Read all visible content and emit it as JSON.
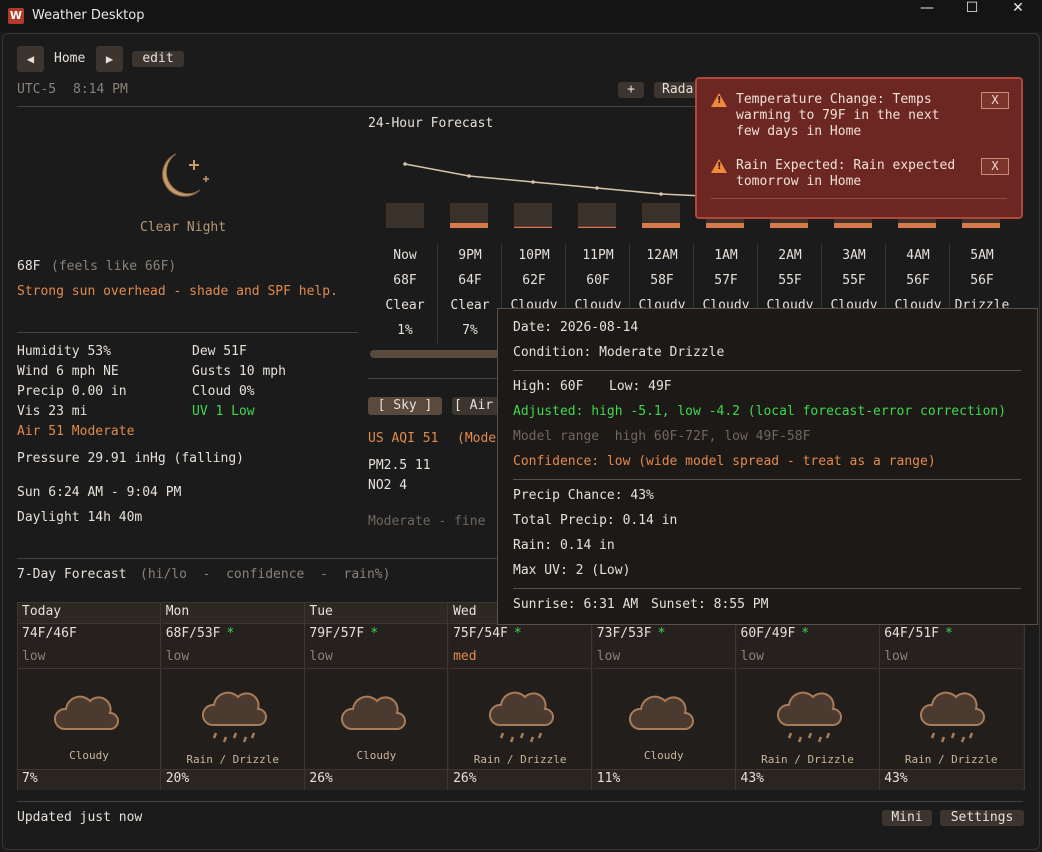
{
  "window": {
    "icon_letter": "W",
    "title": "Weather Desktop",
    "minimize": "—",
    "maximize": "☐",
    "close": "✕"
  },
  "nav": {
    "prev": "◀",
    "location": "Home",
    "next": "▶",
    "edit": "edit"
  },
  "clock": {
    "timezone": "UTC-5",
    "time": "8:14 PM"
  },
  "toolbar": {
    "add": "+",
    "radar": "Radar"
  },
  "current": {
    "icon": "moon-icon",
    "condition": "Clear Night",
    "temp": "68F",
    "feels": "(feels like 66F)",
    "advice": "Strong sun overhead - shade and SPF help.",
    "humidity": "Humidity 53%",
    "dew": "Dew 51F",
    "wind": "Wind 6 mph NE",
    "gusts": "Gusts 10 mph",
    "precip": "Precip 0.00 in",
    "cloud": "Cloud 0%",
    "vis": "Vis 23 mi",
    "uv": "UV 1 Low",
    "air": "Air 51 Moderate",
    "pressure": "Pressure 29.91 inHg (falling)",
    "sun": "Sun  6:24 AM - 9:04 PM",
    "daylight": "Daylight 14h 40m"
  },
  "hourly": {
    "title": "24-Hour Forecast",
    "temps_f": [
      68,
      64,
      62,
      60,
      58,
      57,
      55,
      55,
      56,
      56
    ],
    "precip_pct": [
      1,
      7,
      0,
      0,
      0,
      0,
      0,
      0,
      0,
      0
    ],
    "hours": [
      {
        "time": "Now",
        "temp": "68F",
        "cond": "Clear",
        "precip": "1%"
      },
      {
        "time": "9PM",
        "temp": "64F",
        "cond": "Clear",
        "precip": "7%"
      },
      {
        "time": "10PM",
        "temp": "62F",
        "cond": "Cloudy",
        "precip": ""
      },
      {
        "time": "11PM",
        "temp": "60F",
        "cond": "Cloudy",
        "precip": ""
      },
      {
        "time": "12AM",
        "temp": "58F",
        "cond": "Cloudy",
        "precip": ""
      },
      {
        "time": "1AM",
        "temp": "57F",
        "cond": "Cloudy",
        "precip": ""
      },
      {
        "time": "2AM",
        "temp": "55F",
        "cond": "Cloudy",
        "precip": ""
      },
      {
        "time": "3AM",
        "temp": "55F",
        "cond": "Cloudy",
        "precip": ""
      },
      {
        "time": "4AM",
        "temp": "56F",
        "cond": "Cloudy",
        "precip": ""
      },
      {
        "time": "5AM",
        "temp": "56F",
        "cond": "Drizzle",
        "precip": ""
      }
    ],
    "bar_fill": [
      0.0,
      0.2,
      0.05,
      0.05,
      0.2,
      0.2,
      0.2,
      0.2,
      0.2,
      0.2
    ]
  },
  "air_tabs": {
    "sky": "[ Sky ]",
    "air": "[ Air"
  },
  "air": {
    "aqi": "US AQI 51",
    "aqi_cat": "(Mode",
    "pm25": "PM2.5 11",
    "no2": "NO2 4",
    "note": "Moderate - fine"
  },
  "weekly": {
    "title": "7-Day Forecast",
    "subtitle": "(hi/lo  -  confidence  -  rain%)",
    "days": [
      {
        "day": "Today",
        "temps": "74F/46F",
        "star": "",
        "conf": "low",
        "cond": "Cloudy",
        "rain": "7%",
        "icon": "cloud-icon"
      },
      {
        "day": "Mon",
        "temps": "68F/53F",
        "star": "*",
        "conf": "low",
        "cond": "Rain / Drizzle",
        "rain": "20%",
        "icon": "rain-cloud-icon"
      },
      {
        "day": "Tue",
        "temps": "79F/57F",
        "star": "*",
        "conf": "low",
        "cond": "Cloudy",
        "rain": "26%",
        "icon": "cloud-icon"
      },
      {
        "day": "Wed",
        "temps": "75F/54F",
        "star": "*",
        "conf": "med",
        "cond": "Rain / Drizzle",
        "rain": "26%",
        "icon": "rain-cloud-icon"
      },
      {
        "day": "",
        "temps": "73F/53F",
        "star": "*",
        "conf": "low",
        "cond": "Cloudy",
        "rain": "11%",
        "icon": "cloud-icon"
      },
      {
        "day": "",
        "temps": "60F/49F",
        "star": "*",
        "conf": "low",
        "cond": "Rain / Drizzle",
        "rain": "43%",
        "icon": "rain-cloud-icon"
      },
      {
        "day": "",
        "temps": "64F/51F",
        "star": "*",
        "conf": "low",
        "cond": "Rain / Drizzle",
        "rain": "43%",
        "icon": "rain-cloud-icon"
      }
    ]
  },
  "footer": {
    "updated": "Updated just now",
    "mini": "Mini",
    "settings": "Settings"
  },
  "alerts": [
    {
      "text": "Temperature Change: Temps warming to 79F in the next few days in Home",
      "close": "X"
    },
    {
      "text": "Rain Expected: Rain expected tomorrow in Home",
      "close": "X"
    }
  ],
  "tooltip": {
    "date": "Date: 2026-08-14",
    "condition": "Condition: Moderate Drizzle",
    "high": "High: 60F",
    "low": "Low: 49F",
    "adjusted": "Adjusted: high -5.1, low -4.2 (local forecast-error correction)",
    "model_range": "Model range  high 60F-72F, low 49F-58F",
    "confidence": "Confidence: low (wide model spread - treat as a range)",
    "precip_chance": "Precip Chance: 43%",
    "total_precip": "Total Precip: 0.14 in",
    "rain": "Rain: 0.14 in",
    "max_uv": "Max UV: 2 (Low)",
    "sunrise": "Sunrise: 6:31 AM",
    "sunset": "Sunset: 8:55 PM"
  },
  "colors": {
    "accent": "#e08a4e",
    "good": "#3ed84e",
    "alert_bg": "#6d2722",
    "bg": "#1b1b1b"
  }
}
